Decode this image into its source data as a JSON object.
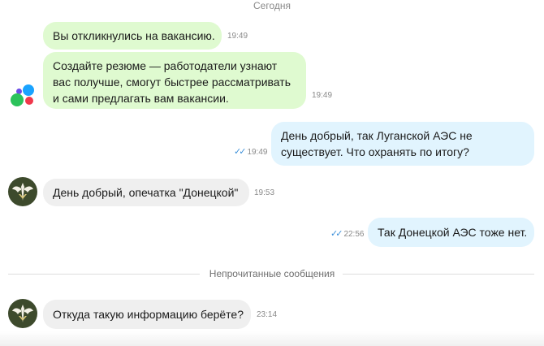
{
  "chat": {
    "day_label": "Сегодня",
    "unread_label": "Непрочитанные сообщения",
    "messages": [
      {
        "text": "Вы откликнулись на вакансию.",
        "time": "19:49"
      },
      {
        "lines": [
          "Создайте резюме —  работодатели узнают",
          "вас получше, смогут быстрее рассматривать",
          "и сами предлагать вам вакансии."
        ],
        "time": "19:49"
      },
      {
        "lines": [
          "День добрый, так Луганской АЭС не",
          "существует. Что охранять по итогу?"
        ],
        "time": "19:49",
        "status": "read"
      },
      {
        "text": "День добрый, опечатка \"Донецкой\"",
        "time": "19:53"
      },
      {
        "text": "Так Донецкой АЭС тоже нет.",
        "time": "22:56",
        "status": "read"
      },
      {
        "text": "Откуда такую информацию берёте?",
        "time": "23:14"
      }
    ]
  },
  "colors": {
    "system_bubble": "#dffad0",
    "outgoing_bubble": "#e1f4fe",
    "incoming_bubble": "#efefef",
    "read_ticks": "#3b8fd9"
  },
  "icons": {
    "read_status": "double-check-icon",
    "employer_avatar": "colored-dots-logo",
    "recruiter_avatar": "emblem-avatar"
  }
}
